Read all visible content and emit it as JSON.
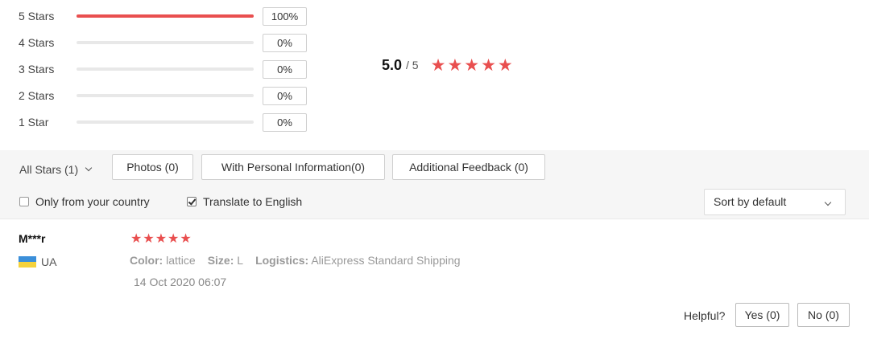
{
  "histogram": [
    {
      "label": "5 Stars",
      "percent_text": "100%",
      "fill_fraction": 1.0
    },
    {
      "label": "4 Stars",
      "percent_text": "0%",
      "fill_fraction": 0
    },
    {
      "label": "3 Stars",
      "percent_text": "0%",
      "fill_fraction": 0
    },
    {
      "label": "2 Stars",
      "percent_text": "0%",
      "fill_fraction": 0
    },
    {
      "label": "1 Star",
      "percent_text": "0%",
      "fill_fraction": 0
    }
  ],
  "summary": {
    "score": "5.0",
    "out_of": "/ 5",
    "stars": 5
  },
  "filters": {
    "all_stars": "All Stars (1)",
    "photos": "Photos (0)",
    "personal_info": "With Personal Information(0)",
    "additional_feedback": "Additional Feedback (0)",
    "only_country": "Only from your country",
    "only_country_checked": false,
    "translate": "Translate to English",
    "translate_checked": true,
    "sort": "Sort by default"
  },
  "review": {
    "reviewer": "M***r",
    "country": "UA",
    "stars": 5,
    "color_key": "Color:",
    "color_val": "lattice",
    "size_key": "Size:",
    "size_val": "L",
    "logistics_key": "Logistics:",
    "logistics_val": "AliExpress Standard Shipping",
    "date": "14 Oct 2020 06:07",
    "helpful_label": "Helpful?",
    "yes": "Yes (0)",
    "no": "No (0)"
  },
  "colors": {
    "accent_red": "#e94f4f",
    "flag_blue": "#3b8fd9",
    "flag_yellow": "#f5d23c"
  }
}
